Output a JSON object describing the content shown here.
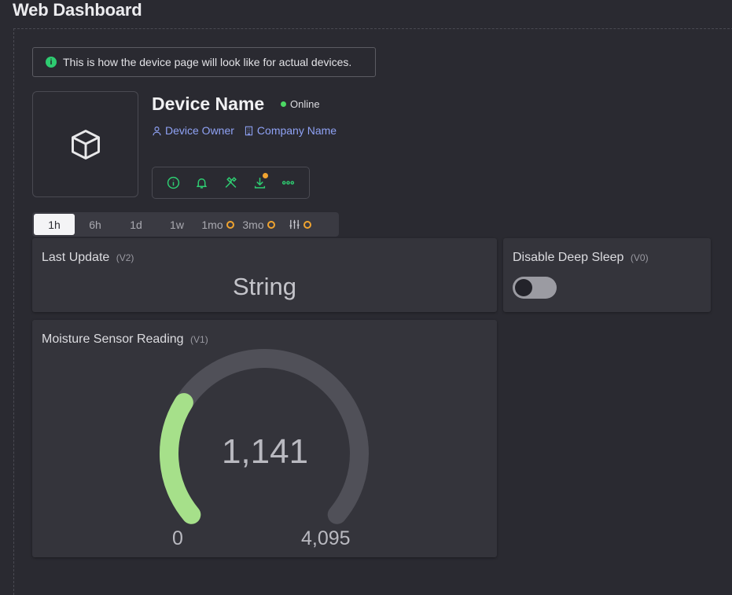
{
  "header": {
    "title": "Web Dashboard"
  },
  "banner": {
    "text": "This is how the device page will look like for actual devices.",
    "icon": "info-icon"
  },
  "device": {
    "name": "Device Name",
    "status": "Online",
    "status_color": "#4cd964",
    "owner_label": "Device Owner",
    "company_label": "Company Name",
    "actions": [
      {
        "icon": "info-icon"
      },
      {
        "icon": "bell-icon"
      },
      {
        "icon": "tools-icon"
      },
      {
        "icon": "download-icon"
      },
      {
        "icon": "more-icon"
      }
    ]
  },
  "time_tabs": [
    {
      "label": "1h",
      "active": true
    },
    {
      "label": "6h"
    },
    {
      "label": "1d"
    },
    {
      "label": "1w"
    },
    {
      "label": "1mo"
    },
    {
      "label": "3mo"
    }
  ],
  "widgets": {
    "last_update": {
      "title": "Last Update",
      "pin": "V2",
      "value": "String"
    },
    "deep_sleep": {
      "title": "Disable Deep Sleep",
      "pin": "V0",
      "state": "off"
    },
    "moisture": {
      "title": "Moisture Sensor Reading",
      "pin": "V1",
      "value": "1,141",
      "min": "0",
      "max": "4,095",
      "fraction": 0.2786,
      "fill_color": "#a6e08a",
      "track_color": "#505058"
    }
  },
  "colors": {
    "accent_link": "#8fa2f5",
    "action_icon": "#2ecc71",
    "badge": "#f0a430"
  }
}
